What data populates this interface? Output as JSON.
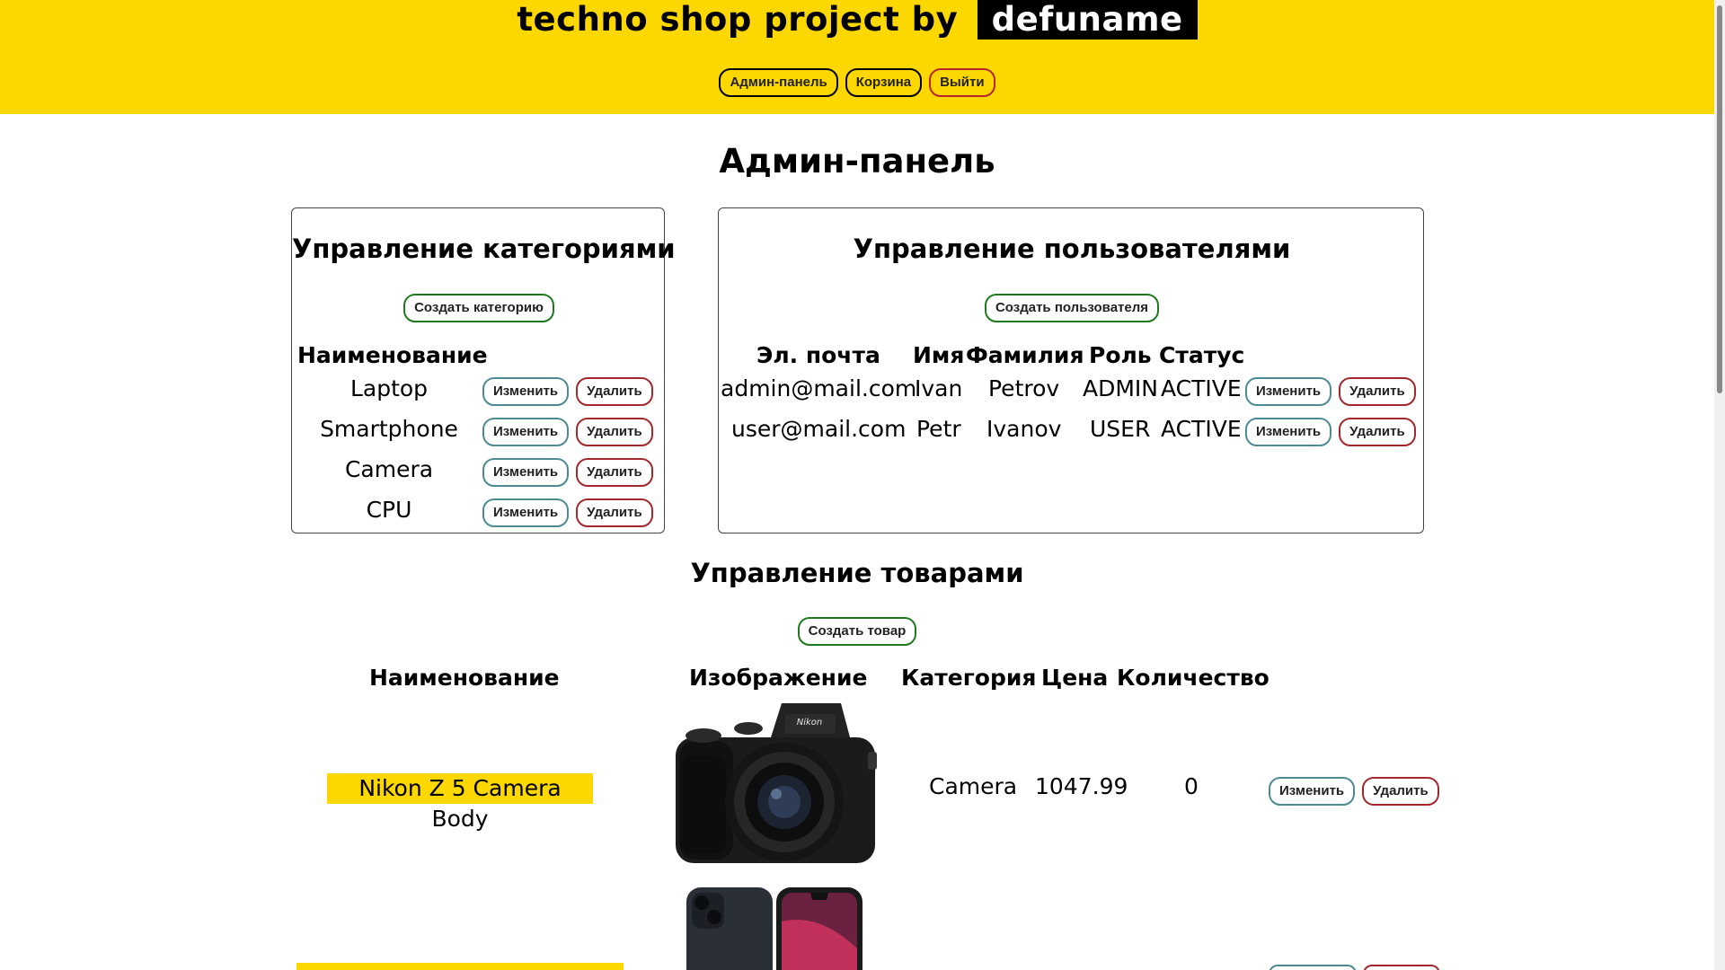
{
  "header": {
    "brand_prefix": "techno shop project by",
    "brand_name": "defuname",
    "nav": [
      "Админ-панель",
      "Корзина",
      "Выйти"
    ]
  },
  "page_title": "Админ-панель",
  "categories": {
    "title": "Управление категориями",
    "create_label": "Создать категорию",
    "col_name": "Наименование",
    "items": [
      "Laptop",
      "Smartphone",
      "Camera",
      "CPU"
    ],
    "edit_label": "Изменить",
    "delete_label": "Удалить"
  },
  "users": {
    "title": "Управление пользователями",
    "create_label": "Создать пользователя",
    "columns": [
      "Эл. почта",
      "Имя",
      "Фамилия",
      "Роль",
      "Статус"
    ],
    "rows": [
      [
        "admin@mail.com",
        "Ivan",
        "Petrov",
        "ADMIN",
        "ACTIVE"
      ],
      [
        "user@mail.com",
        "Petr",
        "Ivanov",
        "USER",
        "ACTIVE"
      ]
    ],
    "edit_label": "Изменить",
    "delete_label": "Удалить"
  },
  "products": {
    "title": "Управление товарами",
    "create_label": "Создать товар",
    "columns": [
      "Наименование",
      "Изображение",
      "Категория",
      "Цена",
      "Количество"
    ],
    "rows": [
      {
        "name": "Nikon Z 5 Camera Body",
        "image_icon": "camera-photo-icon",
        "category": "Camera",
        "price": "1047.99",
        "quantity": "0"
      }
    ],
    "second_row_image_icon": "smartphone-photo-icon",
    "edit_label": "Изменить",
    "delete_label": "Удалить"
  },
  "colors": {
    "accent_yellow": "#fdd700",
    "green": "#1f7a1f",
    "teal": "#4d8a91",
    "red": "#a3282c"
  }
}
